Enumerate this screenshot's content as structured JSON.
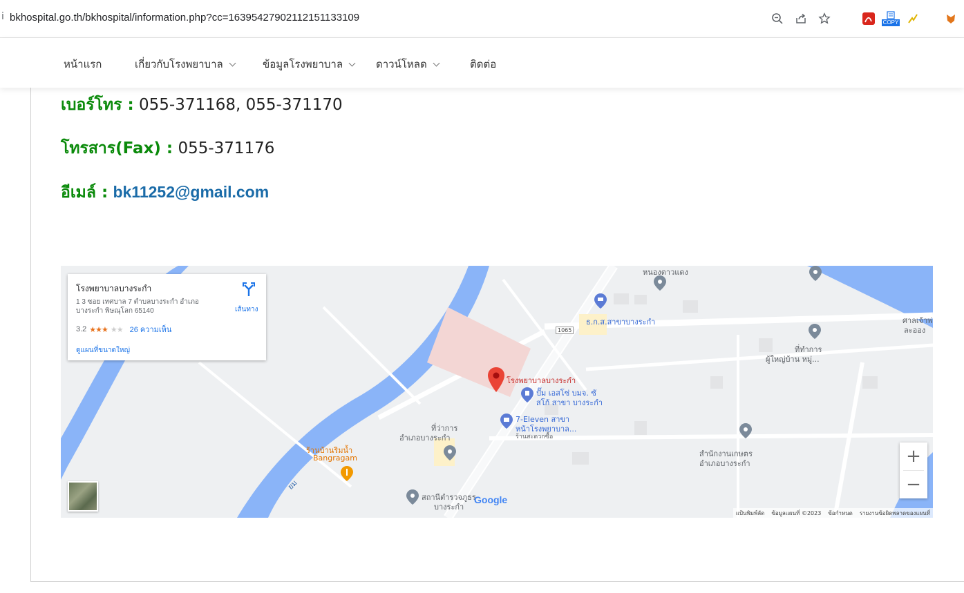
{
  "browser": {
    "url": "bkhospital.go.th/bkhospital/information.php?cc=16395427902112151133109",
    "copy_badge": "COPY"
  },
  "nav": {
    "items": [
      {
        "label": "หน้าแรก",
        "dropdown": false
      },
      {
        "label": "เกี่ยวกับโรงพยาบาล",
        "dropdown": true
      },
      {
        "label": "ข้อมูลโรงพยาบาล",
        "dropdown": true
      },
      {
        "label": "ดาวน์โหลด",
        "dropdown": true
      },
      {
        "label": "ติดต่อ",
        "dropdown": false
      }
    ]
  },
  "contact": {
    "phone_label": "เบอร์โทร :",
    "phone_value": "055-371168, 055-371170",
    "fax_label": "โทรสาร(Fax) :",
    "fax_value": "055-371176",
    "email_label": "อีเมล์ :",
    "email_value": "bk11252@gmail.com"
  },
  "map": {
    "card": {
      "title": "โรงพยาบาลบางระกำ",
      "address": "1 3 ซอย เทศบาล 7 ตำบลบางระกำ อำเภอบางระกำ พิษณุโลก 65140",
      "rating": "3.2",
      "stars_on": "★★★",
      "stars_off": "★★",
      "reviews": "26 ความเห็น",
      "larger_map": "ดูแผนที่ขนาดใหญ่",
      "directions": "เส้นทาง"
    },
    "labels": {
      "hospital": "โรงพยาบาลบางระกำ",
      "baac": "ธ.ก.ส.สาขาบางระกำ",
      "road_number": "1065",
      "village_office_1": "ที่ทำการ",
      "village_office_2": "ผู้ใหญ่บ้าน หมู่...",
      "shrine_1": "ศาลเจ้าพ่",
      "shrine_2": "ละออง",
      "gas_1": "ปั๊ม เอสโซ่ บมจ. ซั",
      "gas_2": "สโก้ สาขา บางระกำ",
      "seven_1": "7-Eleven สาขา",
      "seven_2": "หน้าโรงพยาบาล...",
      "seven_3": "ร้านสะดวกซื้อ",
      "district_1": "ที่ว่าการ",
      "district_2": "อำเภอบางระกำ",
      "restaurant_1": "ร้านบ้านริมน้ำ",
      "restaurant_2": "Bangragam",
      "agri_1": "สำนักงานเกษตร",
      "agri_2": "อำเภอบางระกำ",
      "police_1": "สถานีตำรวจภูธร",
      "police_2": "บางระกำ",
      "river": "ยม",
      "top_place": "หนองตาวแดง",
      "google": "Google",
      "footer_shortcuts": "แป้นพิมพ์ลัด",
      "footer_data": "ข้อมูลแผนที่ ©2023",
      "footer_terms": "ข้อกำหนด",
      "footer_report": "รายงานข้อผิดพลาดของแผนที่"
    },
    "zoom_in": "+",
    "zoom_out": "−"
  }
}
